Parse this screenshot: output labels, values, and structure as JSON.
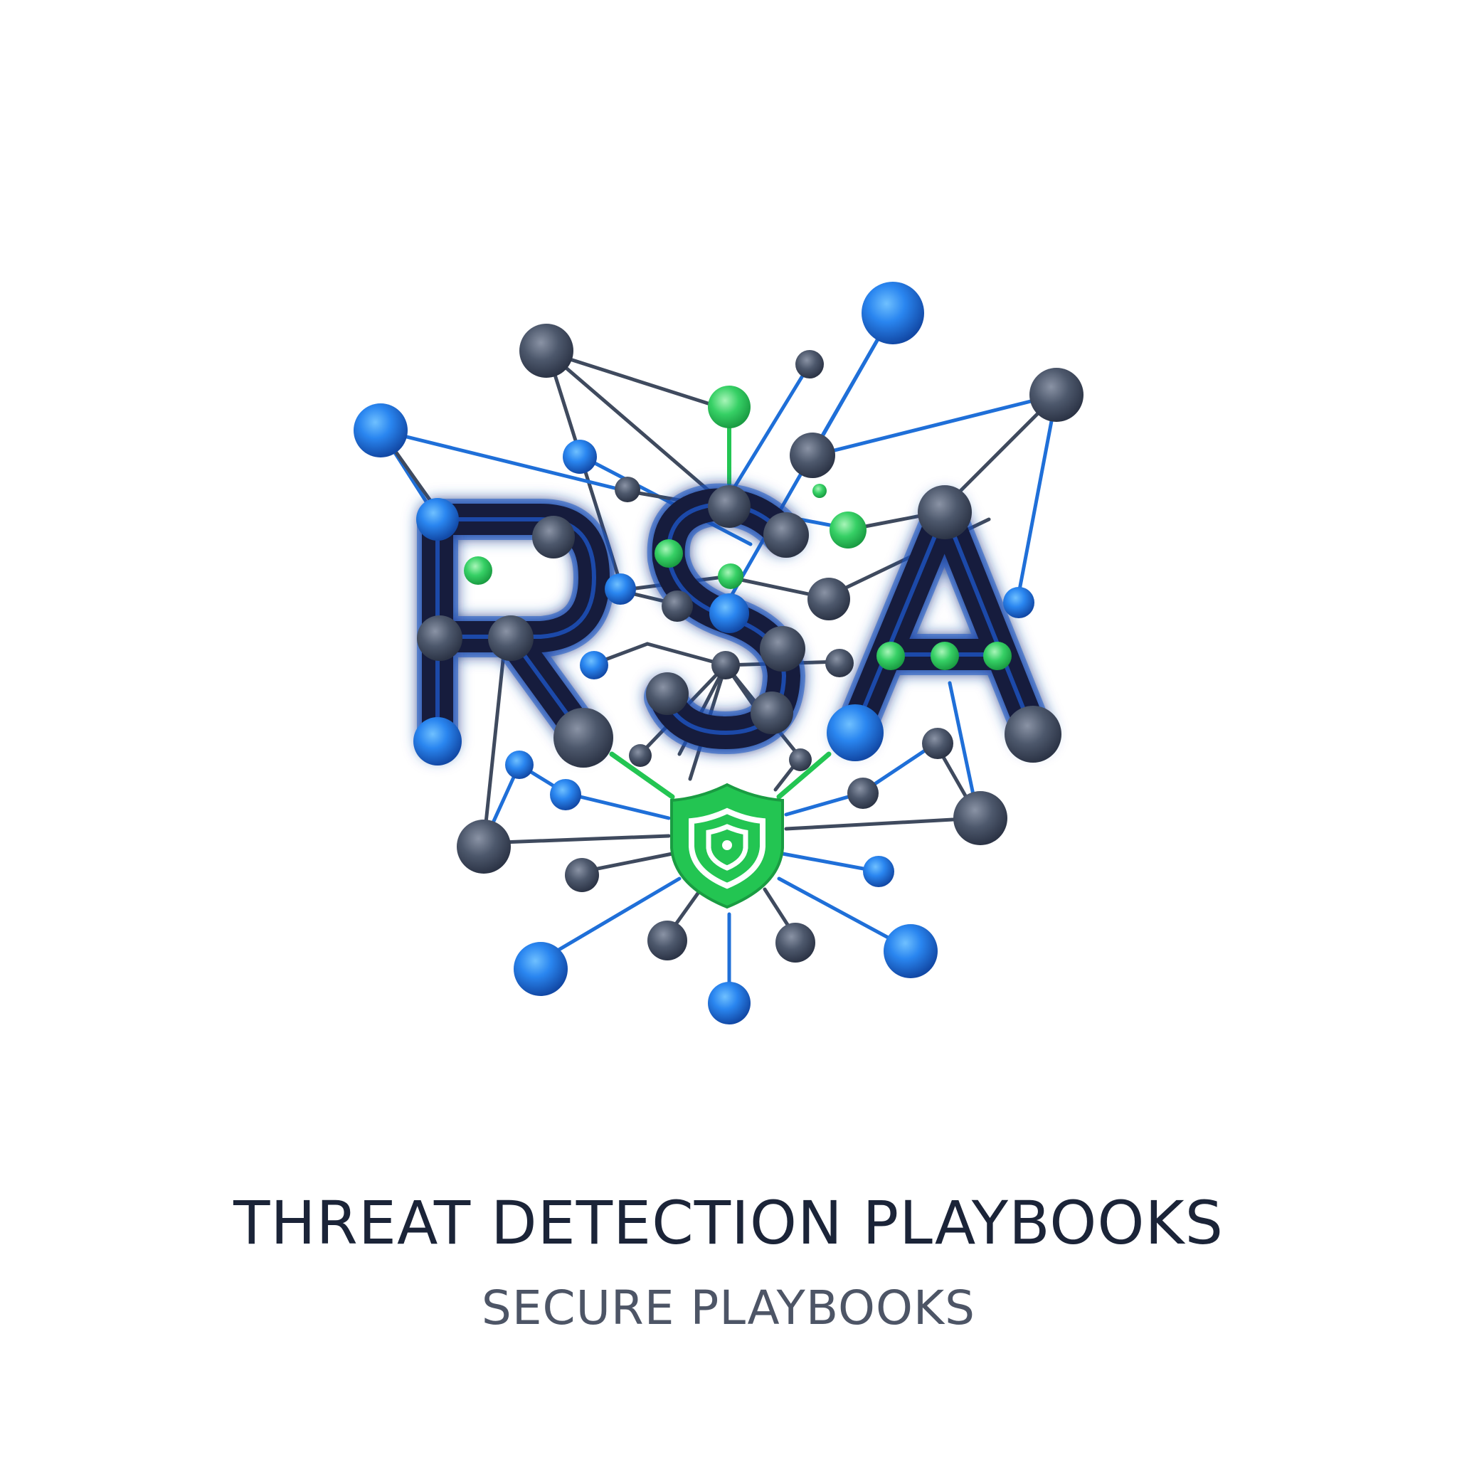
{
  "logo": {
    "letters": [
      "R",
      "S",
      "A"
    ],
    "icon": "shield-icon",
    "colors": {
      "navy": "#15244a",
      "blue": "#1f6fd8",
      "green": "#23c552",
      "gray_node": "#3f4a5e"
    }
  },
  "title": "THREAT DETECTION PLAYBOOKS",
  "subtitle": "SECURE PLAYBOOKS"
}
